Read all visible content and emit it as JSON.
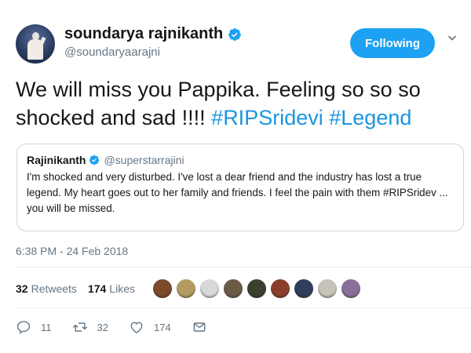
{
  "author": {
    "display_name": "soundarya rajnikanth",
    "handle": "@soundaryaarajni",
    "verified": true,
    "follow_label": "Following"
  },
  "tweet": {
    "text_plain": "We will miss you Pappika. Feeling so so so shocked and sad !!!! ",
    "hashtag_1": "#RIPSridevi",
    "hashtag_2": "#Legend",
    "timestamp": "6:38 PM - 24 Feb 2018"
  },
  "quoted_tweet": {
    "display_name": "Rajinikanth",
    "handle": "@superstarrajini",
    "verified": true,
    "text": "I'm shocked and very disturbed. I've lost a dear friend and the industry has lost a true legend. My heart goes out to her family and friends. I feel the pain with them #RIPSridev ... you will be missed."
  },
  "stats": {
    "retweets_count": "32",
    "retweets_label": "Retweets",
    "likes_count": "174",
    "likes_label": "Likes"
  },
  "likers_colors": [
    "#7a4a2a",
    "#b39b63",
    "#d8d8d8",
    "#6b5a48",
    "#3b3f2e",
    "#8a3f2a",
    "#2f3e5a",
    "#c8c3b8",
    "#8a6f9a"
  ],
  "actions": {
    "reply_count": "11",
    "retweet_count": "32",
    "like_count": "174"
  },
  "colors": {
    "accent": "#1da1f2",
    "hashtag": "#1b95e0",
    "muted": "#657786"
  }
}
